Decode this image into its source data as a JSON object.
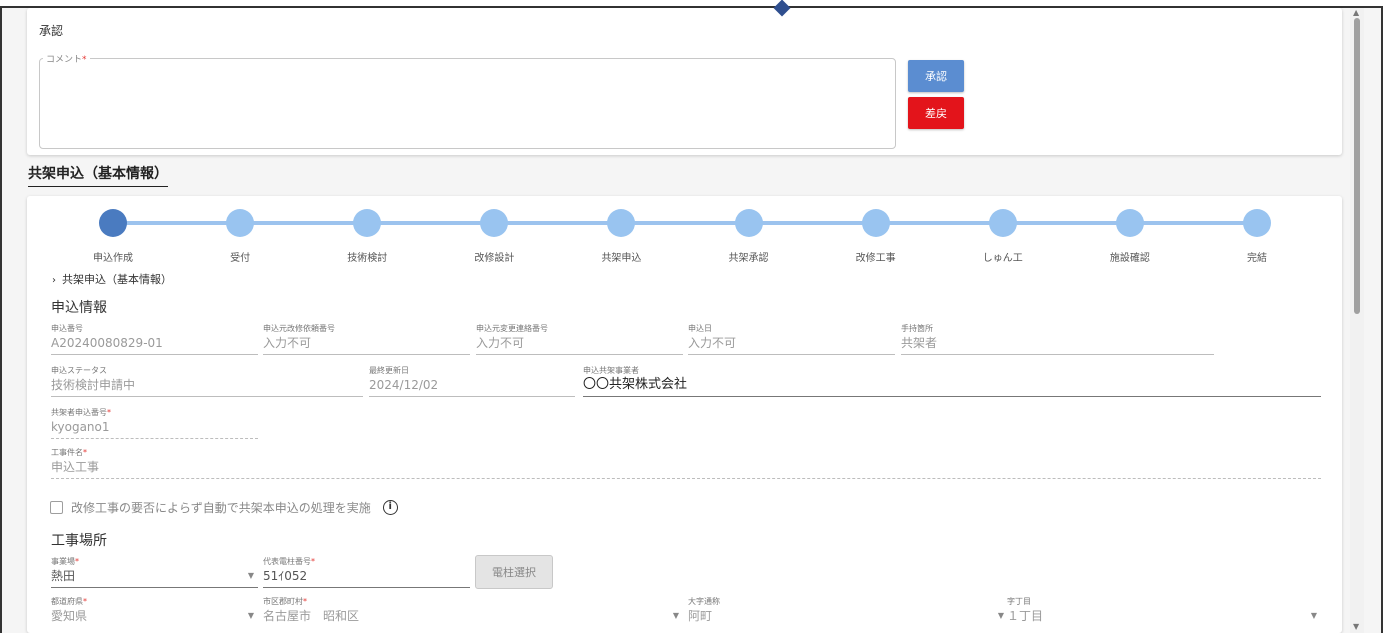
{
  "approval": {
    "title": "承認",
    "comment_label": "コメント",
    "required_mark": "*",
    "approve_label": "承認",
    "reject_label": "差戻"
  },
  "section_heading": "共架申込（基本情報）",
  "steps": [
    {
      "label": "申込作成",
      "state": "current"
    },
    {
      "label": "受付",
      "state": "pending"
    },
    {
      "label": "技術検討",
      "state": "pending"
    },
    {
      "label": "改修設計",
      "state": "pending"
    },
    {
      "label": "共架申込",
      "state": "pending"
    },
    {
      "label": "共架承認",
      "state": "pending"
    },
    {
      "label": "改修工事",
      "state": "pending"
    },
    {
      "label": "しゅん工",
      "state": "pending"
    },
    {
      "label": "施設確認",
      "state": "pending"
    },
    {
      "label": "完結",
      "state": "pending"
    }
  ],
  "breadcrumb": "共架申込（基本情報）",
  "application_info": {
    "title": "申込情報",
    "application_no": {
      "label": "申込番号",
      "value": "A20240080829-01"
    },
    "repair_request_no": {
      "label": "申込元改修依頼番号",
      "value": "入力不可"
    },
    "change_request_no": {
      "label": "申込元変更連絡番号",
      "value": "入力不可"
    },
    "application_date": {
      "label": "申込日",
      "value": "入力不可"
    },
    "handler": {
      "label": "手持箇所",
      "value": "共架者"
    },
    "status": {
      "label": "申込ステータス",
      "value": "技術検討申請中"
    },
    "last_updated": {
      "label": "最終更新日",
      "value": "2024/12/02"
    },
    "applicant": {
      "label": "申込共架事業者",
      "value": "〇〇共架株式会社"
    },
    "applicant_no": {
      "label": "共架者申込番号",
      "value": "kyogano1"
    },
    "project_name": {
      "label": "工事件名",
      "value": "申込工事"
    },
    "auto_process_label": "改修工事の要否によらず自動で共架本申込の処理を実施"
  },
  "work_location": {
    "title": "工事場所",
    "office": {
      "label": "事業場",
      "value": "熱田"
    },
    "pole_no": {
      "label": "代表電柱番号",
      "value": "51ｲ052"
    },
    "pole_select_label": "電柱選択",
    "prefecture": {
      "label": "都道府県",
      "value": "愛知県"
    },
    "city": {
      "label": "市区郡町村",
      "value": "名古屋市　昭和区"
    },
    "district": {
      "label": "大字通称",
      "value": "阿町"
    },
    "chome": {
      "label": "字丁目",
      "value": "１丁目"
    }
  },
  "colors": {
    "approve": "#5b8dd1",
    "reject": "#e3141b",
    "step_active": "#4a7bc0",
    "step_pending": "#99c4f0"
  }
}
